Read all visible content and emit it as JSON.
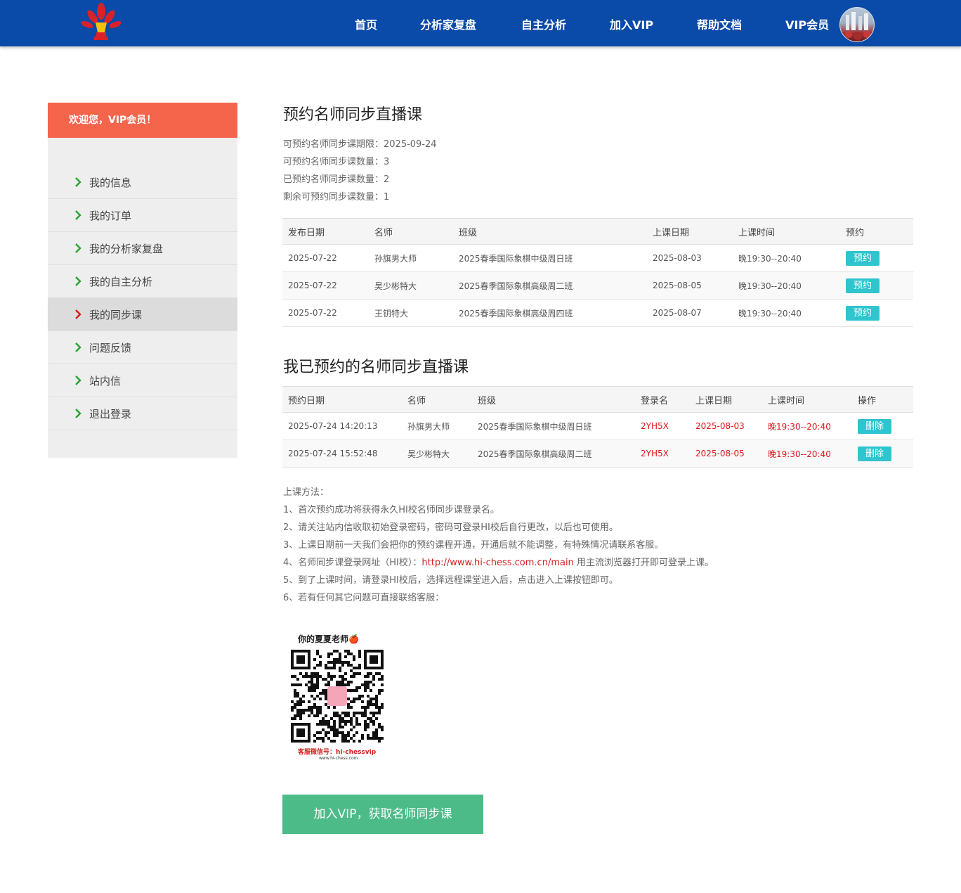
{
  "header": {
    "nav": [
      "首页",
      "分析家复盘",
      "自主分析",
      "加入VIP",
      "帮助文档",
      "VIP会员"
    ],
    "logo_icon": "chess-flower-logo",
    "avatar_icon": "user-avatar"
  },
  "sidebar": {
    "welcome": "欢迎您，VIP会员！",
    "items": [
      {
        "label": "我的信息",
        "active": false
      },
      {
        "label": "我的订单",
        "active": false
      },
      {
        "label": "我的分析家复盘",
        "active": false
      },
      {
        "label": "我的自主分析",
        "active": false
      },
      {
        "label": "我的同步课",
        "active": true
      },
      {
        "label": "问题反馈",
        "active": false
      },
      {
        "label": "站内信",
        "active": false
      },
      {
        "label": "退出登录",
        "active": false
      }
    ]
  },
  "booking": {
    "title": "预约名师同步直播课",
    "info": [
      "可预约名师同步课期限：2025-09-24",
      "可预约名师同步课数量：3",
      "已预约名师同步课数量：2",
      "剩余可预约同步课数量：1"
    ],
    "columns": [
      "发布日期",
      "名师",
      "班级",
      "上课日期",
      "上课时间",
      "预约"
    ],
    "rows": [
      {
        "date": "2025-07-22",
        "teacher": "孙旗男大师",
        "class": "2025春季国际象棋中级周日班",
        "lesson_date": "2025-08-03",
        "time": "晚19:30--20:40",
        "action": "预约"
      },
      {
        "date": "2025-07-22",
        "teacher": "吴少彬特大",
        "class": "2025春季国际象棋高级周二班",
        "lesson_date": "2025-08-05",
        "time": "晚19:30--20:40",
        "action": "预约"
      },
      {
        "date": "2025-07-22",
        "teacher": "王钥特大",
        "class": "2025春季国际象棋高级周四班",
        "lesson_date": "2025-08-07",
        "time": "晚19:30--20:40",
        "action": "预约"
      }
    ]
  },
  "booked": {
    "title": "我已预约的名师同步直播课",
    "columns": [
      "预约日期",
      "名师",
      "班级",
      "登录名",
      "上课日期",
      "上课时间",
      "操作"
    ],
    "rows": [
      {
        "date": "2025-07-24 14:20:13",
        "teacher": "孙旗男大师",
        "class": "2025春季国际象棋中级周日班",
        "login": "2YH5X",
        "lesson_date": "2025-08-03",
        "time": "晚19:30--20:40",
        "action": "删除"
      },
      {
        "date": "2025-07-24 15:52:48",
        "teacher": "吴少彬特大",
        "class": "2025春季国际象棋高级周二班",
        "login": "2YH5X",
        "lesson_date": "2025-08-05",
        "time": "晚19:30--20:40",
        "action": "删除"
      }
    ]
  },
  "method": {
    "heading": "上课方法：",
    "lines": [
      "1、首次预约成功将获得永久HI校名师同步课登录名。",
      "2、请关注站内信收取初始登录密码，密码可登录HI校后自行更改，以后也可使用。",
      "3、上课日期前一天我们会把你的预约课程开通，开通后就不能调整，有特殊情况请联系客服。"
    ],
    "line4_prefix": "4、名师同步课登录网址（HI校）：",
    "line4_link": "http://www.hi-chess.com.cn/main",
    "line4_suffix": " 用主流浏览器打开即可登录上课。",
    "lines_after": [
      "5、到了上课时间，请登录HI校后，选择远程课堂进入后，点击进入上课按钮即可。",
      "6、若有任何其它问题可直接联络客服："
    ]
  },
  "qr": {
    "title": "你的夏夏老师🍎",
    "footer": "客服微信号：hi-chessvip",
    "footer2": "www.hi-chess.com"
  },
  "join_button": "加入VIP，获取名师同步课",
  "colors": {
    "header": "#0a4aa8",
    "sidebar_head": "#f4654c",
    "action_button": "#2ec5cf",
    "join_button": "#4cbb88",
    "highlight_red": "#e0161b"
  }
}
